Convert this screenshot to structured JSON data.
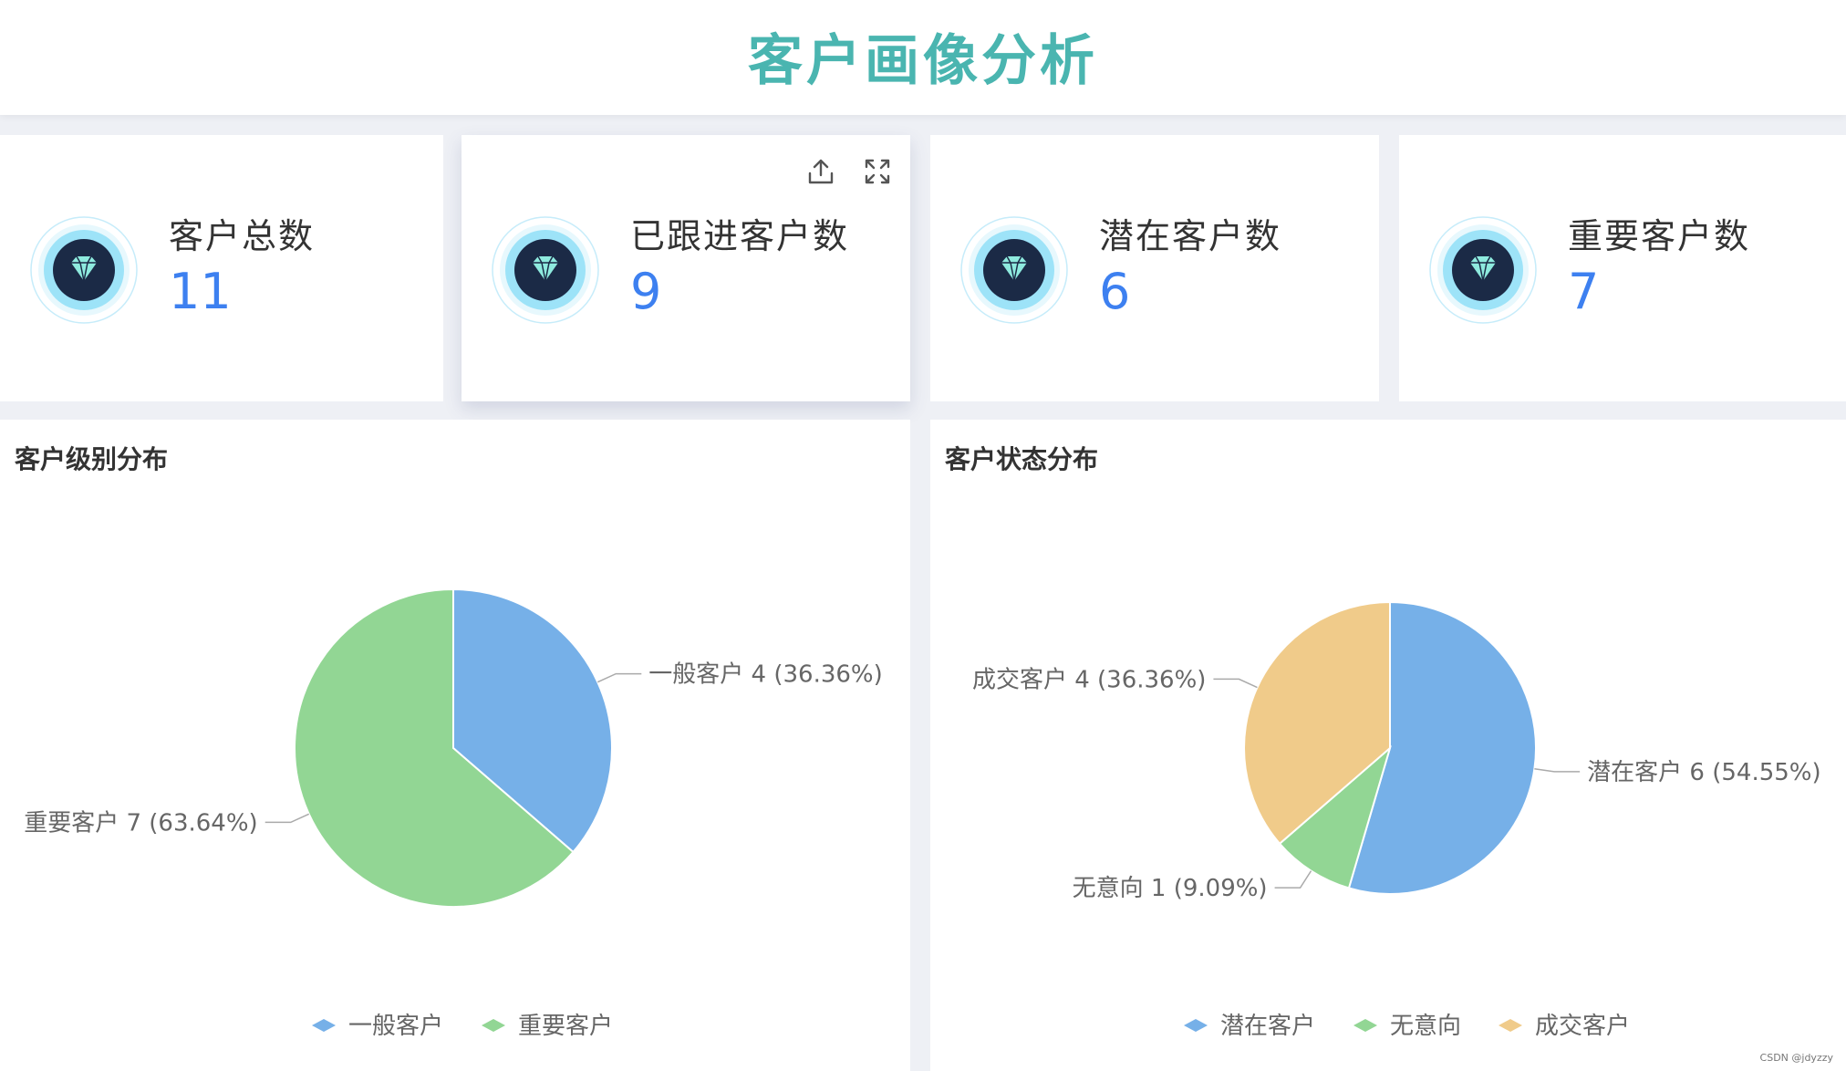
{
  "title": "客户画像分析",
  "cards": [
    {
      "label": "客户总数",
      "value": "11"
    },
    {
      "label": "已跟进客户数",
      "value": "9"
    },
    {
      "label": "潜在客户数",
      "value": "6"
    },
    {
      "label": "重要客户数",
      "value": "7"
    }
  ],
  "icons": {
    "card": "diamond-icon",
    "export": "export-icon",
    "fullscreen": "fullscreen-icon"
  },
  "colors": {
    "blue": "#76b0e8",
    "green": "#92d694",
    "orange": "#f0cb8a",
    "title": "#4ab5b0",
    "value": "#3d80f0"
  },
  "chart_data": [
    {
      "type": "pie",
      "title": "客户级别分布",
      "legend_placement": "bottom",
      "slices": [
        {
          "name": "一般客户",
          "value": 4,
          "percent": "36.36%",
          "color": "#76b0e8"
        },
        {
          "name": "重要客户",
          "value": 7,
          "percent": "63.64%",
          "color": "#92d694"
        }
      ],
      "labels": [
        "一般客户  4 (36.36%)",
        "重要客户  7 (63.64%)"
      ]
    },
    {
      "type": "pie",
      "title": "客户状态分布",
      "legend_placement": "bottom",
      "slices": [
        {
          "name": "潜在客户",
          "value": 6,
          "percent": "54.55%",
          "color": "#76b0e8"
        },
        {
          "name": "无意向",
          "value": 1,
          "percent": "9.09%",
          "color": "#92d694"
        },
        {
          "name": "成交客户",
          "value": 4,
          "percent": "36.36%",
          "color": "#f0cb8a"
        }
      ],
      "labels": [
        "潜在客户  6 (54.55%)",
        "无意向  1 (9.09%)",
        "成交客户  4 (36.36%)"
      ]
    }
  ],
  "watermark": "CSDN @jdyzzy"
}
